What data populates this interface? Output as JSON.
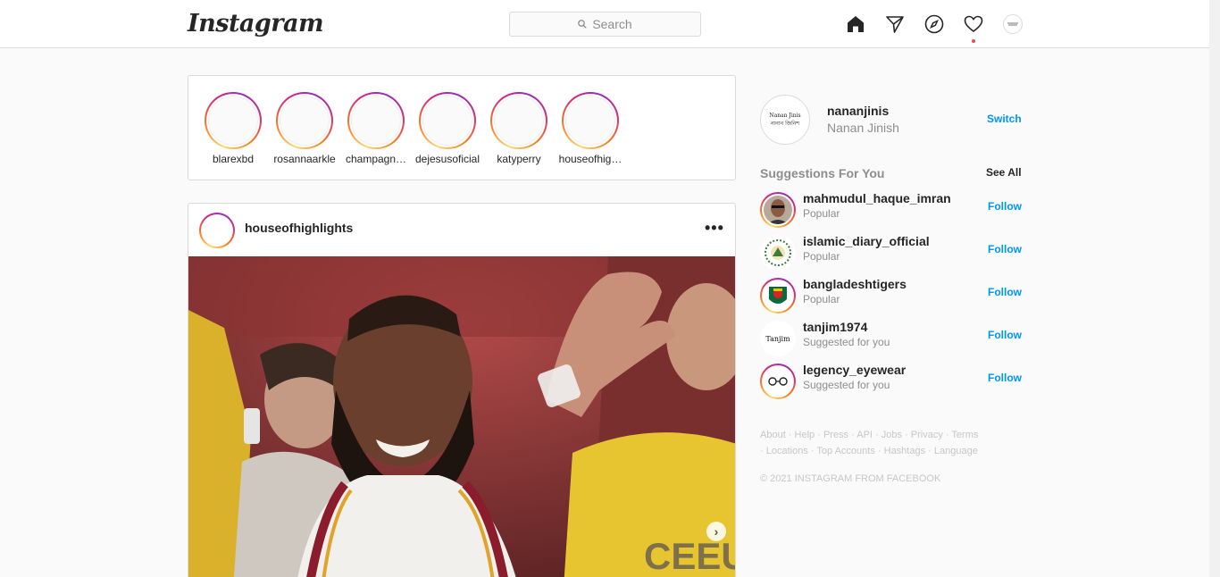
{
  "header": {
    "logo": "Instagram",
    "search_placeholder": "Search",
    "nav_icons": [
      "home-icon",
      "direct-icon",
      "explore-icon",
      "activity-icon",
      "profile-icon"
    ],
    "notification_color": "#ed4956"
  },
  "stories": [
    {
      "username": "blarexbd"
    },
    {
      "username": "rosannaarkle"
    },
    {
      "username": "champagn…"
    },
    {
      "username": "dejesusoficial"
    },
    {
      "username": "katyperry"
    },
    {
      "username": "houseofhig…"
    }
  ],
  "post": {
    "username": "houseofhighlights",
    "more": "•••",
    "next": "›"
  },
  "sidebar": {
    "me_username": "nananjinis",
    "me_fullname": "Nanan Jinish",
    "me_avatar_text_1": "Nanan Jinis",
    "me_avatar_text_2": "নানান জিনিশ",
    "switch_label": "Switch",
    "suggestions_title": "Suggestions For You",
    "see_all_label": "See All",
    "follow_label": "Follow",
    "suggestions": [
      {
        "username": "mahmudul_haque_imran",
        "sub": "Popular"
      },
      {
        "username": "islamic_diary_official",
        "sub": "Popular"
      },
      {
        "username": "bangladeshtigers",
        "sub": "Popular"
      },
      {
        "username": "tanjim1974",
        "sub": "Suggested for you",
        "avatar_text": "Tanjim"
      },
      {
        "username": "legency_eyewear",
        "sub": "Suggested for you"
      }
    ],
    "footer_links": [
      "About",
      "Help",
      "Press",
      "API",
      "Jobs",
      "Privacy",
      "Terms",
      "Locations",
      "Top Accounts",
      "Hashtags",
      "Language"
    ],
    "copyright": "© 2021 INSTAGRAM FROM FACEBOOK"
  },
  "colors": {
    "link_blue": "#0095f6",
    "muted_text": "#8e8e8e",
    "border": "#dbdbdb"
  }
}
